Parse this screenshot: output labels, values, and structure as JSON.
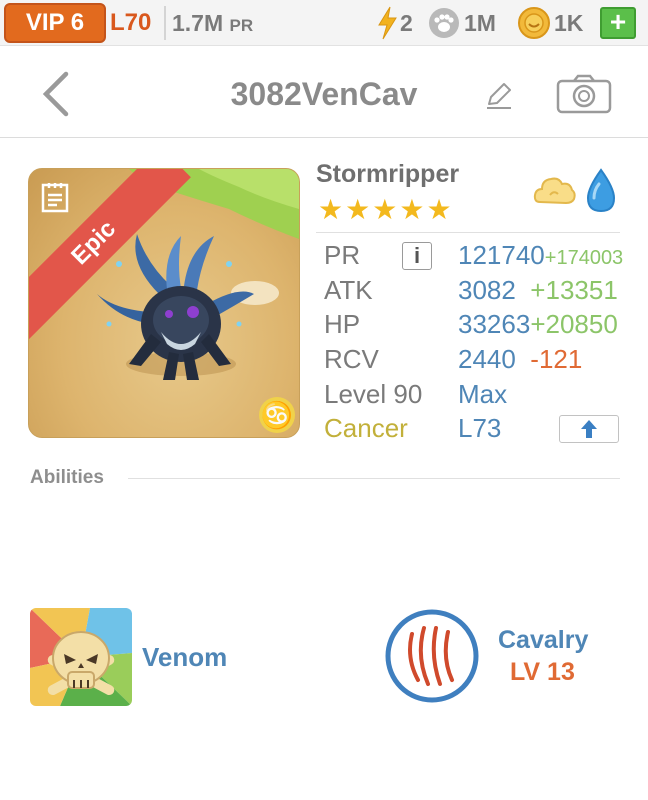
{
  "status_bar": {
    "vip": "VIP 6",
    "player_level": "L70",
    "power": "1.7M",
    "power_unit": "PR",
    "energy": "2",
    "food": "1M",
    "coins": "1K",
    "add_label": "+",
    "colors": {
      "vip": "#e26a1e",
      "level": "#d9581d",
      "add": "#5bbf4a"
    }
  },
  "header": {
    "title": "3082VenCav",
    "back_icon": "chevron-left-icon",
    "edit_icon": "pencil-icon",
    "camera_icon": "camera-icon"
  },
  "monster": {
    "name": "Stormripper",
    "rarity": "Epic",
    "stars": 5,
    "elements": [
      "light-cloud-icon",
      "water-drop-icon"
    ],
    "zodiac_symbol": "♋",
    "stats": {
      "pr": {
        "label": "PR",
        "value": "121740",
        "bonus": "+174003",
        "info": "i"
      },
      "atk": {
        "label": "ATK",
        "value": "3082",
        "bonus": "+13351"
      },
      "hp": {
        "label": "HP",
        "value": "33263",
        "bonus": "+20850"
      },
      "rcv": {
        "label": "RCV",
        "value": "2440",
        "bonus": "-121"
      },
      "level": {
        "label": "Level 90",
        "value": "Max"
      },
      "zodiac": {
        "label": "Cancer",
        "value": "L73"
      }
    }
  },
  "abilities": {
    "heading": "Abilities",
    "venom": {
      "name": "Venom"
    },
    "cavalry": {
      "name": "Cavalry",
      "level": "LV 13"
    }
  }
}
